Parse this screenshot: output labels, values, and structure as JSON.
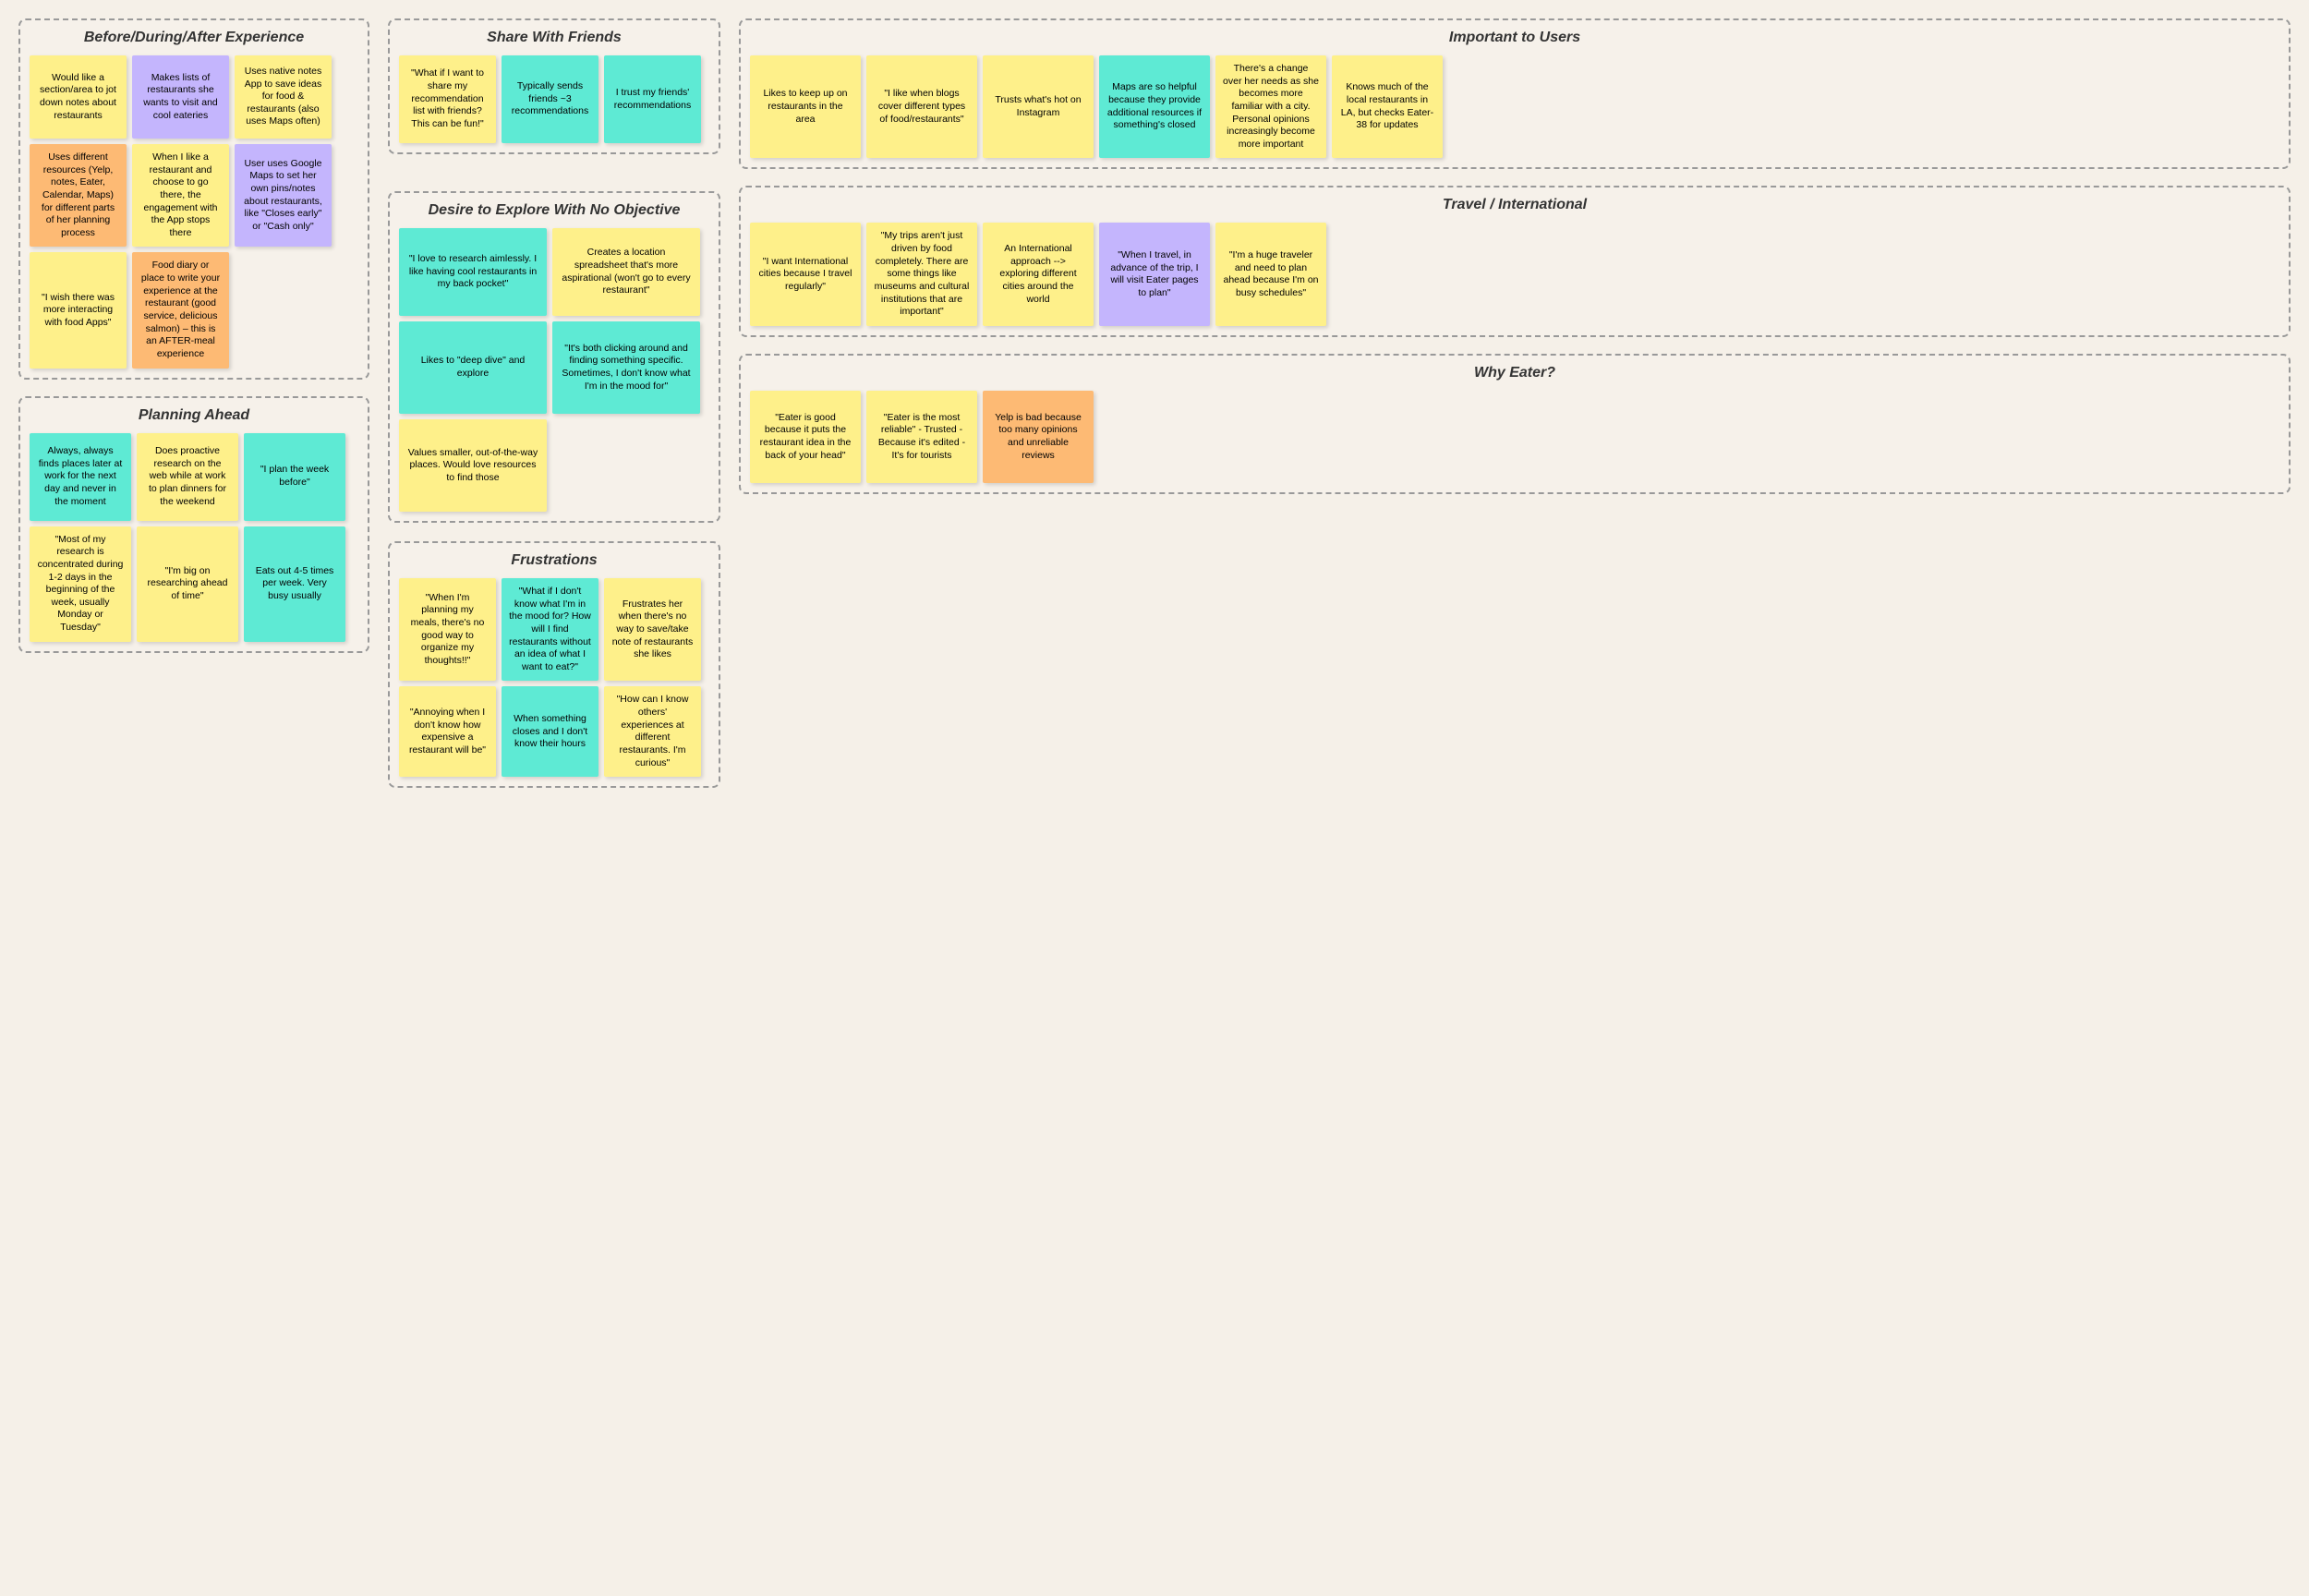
{
  "sections": {
    "before_during_after": {
      "title": "Before/During/After Experience",
      "stickies": [
        {
          "text": "Would like a section/area to jot down notes about restaurants",
          "color": "yellow"
        },
        {
          "text": "Makes lists of restaurants she wants to visit and cool eateries",
          "color": "purple"
        },
        {
          "text": "Uses native notes App to save ideas for food & restaurants (also uses Maps often)",
          "color": "yellow"
        },
        {
          "text": "Uses different resources (Yelp, notes, Eater, Calendar, Maps) for different parts of her planning process",
          "color": "orange"
        },
        {
          "text": "When I like a restaurant and choose to go there, the engagement with the App stops there",
          "color": "yellow"
        },
        {
          "text": "User uses Google Maps to set her own pins/notes about restaurants, like \"Closes early\" or \"Cash only\"",
          "color": "purple"
        },
        {
          "text": "\"I wish there was more interacting with food Apps\"",
          "color": "yellow"
        },
        {
          "text": "Food diary or place to write your experience at the restaurant (good service, delicious salmon) – this is an AFTER-meal experience",
          "color": "orange"
        }
      ]
    },
    "planning_ahead": {
      "title": "Planning Ahead",
      "stickies": [
        {
          "text": "Always, always finds places later at work for the next day and never in the moment",
          "color": "teal"
        },
        {
          "text": "Does proactive research on the web while at work to plan dinners for the weekend",
          "color": "yellow"
        },
        {
          "text": "\"I plan the week before\"",
          "color": "teal"
        },
        {
          "text": "\"Most of my research is concentrated during 1-2 days in the beginning of the week, usually Monday or Tuesday\"",
          "color": "yellow"
        },
        {
          "text": "\"I'm big on researching ahead of time\"",
          "color": "yellow"
        },
        {
          "text": "Eats out 4-5 times per week. Very busy usually",
          "color": "teal"
        }
      ]
    },
    "share_with_friends": {
      "title": "Share With Friends",
      "stickies": [
        {
          "text": "\"What if I want to share my recommendation list with friends? This can be fun!\"",
          "color": "yellow"
        },
        {
          "text": "Typically sends friends ~3 recommendations",
          "color": "teal"
        },
        {
          "text": "I trust my friends' recommendations",
          "color": "teal"
        }
      ]
    },
    "desire_explore": {
      "title": "Desire to Explore With No Objective",
      "stickies": [
        {
          "text": "\"I love to research aimlessly. I like having cool restaurants in my back pocket\"",
          "color": "teal"
        },
        {
          "text": "Creates a location spreadsheet that's more aspirational (won't go to every restaurant\"",
          "color": "yellow"
        },
        {
          "text": "Likes to \"deep dive\" and explore",
          "color": "teal"
        },
        {
          "text": "\"It's both clicking around and finding something specific. Sometimes, I don't know what I'm in the mood for\"",
          "color": "teal"
        },
        {
          "text": "Values smaller, out-of-the-way places. Would love resources to find those",
          "color": "yellow"
        }
      ]
    },
    "frustrations": {
      "title": "Frustrations",
      "stickies": [
        {
          "text": "\"When I'm planning my meals, there's no good way to organize my thoughts!!\"",
          "color": "yellow"
        },
        {
          "text": "\"What if I don't know what I'm in the mood for? How will I find restaurants without an idea of what I want to eat?\"",
          "color": "teal"
        },
        {
          "text": "Frustrates her when there's no way to save/take note of restaurants she likes",
          "color": "yellow"
        },
        {
          "text": "\"Annoying when I don't know how expensive a restaurant will be\"",
          "color": "yellow"
        },
        {
          "text": "When something closes and I don't know their hours",
          "color": "teal"
        },
        {
          "text": "\"How can I know others' experiences at different restaurants. I'm curious\"",
          "color": "yellow"
        }
      ]
    },
    "important_to_users": {
      "title": "Important to Users",
      "stickies": [
        {
          "text": "Likes to keep up on restaurants in the area",
          "color": "yellow"
        },
        {
          "text": "\"I like when blogs cover different types of food/restaurants\"",
          "color": "yellow"
        },
        {
          "text": "Trusts what's hot on Instagram",
          "color": "yellow"
        },
        {
          "text": "Maps are so helpful because they provide additional resources if something's closed",
          "color": "teal"
        },
        {
          "text": "There's a change over her needs as she becomes more familiar with a city. Personal opinions increasingly become more important",
          "color": "yellow"
        },
        {
          "text": "Knows much of the local restaurants in LA, but checks Eater-38 for updates",
          "color": "yellow"
        }
      ]
    },
    "travel_international": {
      "title": "Travel / International",
      "stickies": [
        {
          "text": "\"I want International cities because I travel regularly\"",
          "color": "yellow"
        },
        {
          "text": "\"My trips aren't just driven by food completely. There are some things like museums and cultural institutions that are important\"",
          "color": "yellow"
        },
        {
          "text": "An International approach --> exploring different cities around the world",
          "color": "yellow"
        },
        {
          "text": "\"When I travel, in advance of the trip, I will visit Eater pages to plan\"",
          "color": "purple"
        },
        {
          "text": "\"I'm a huge traveler and need to plan ahead because I'm on busy schedules\"",
          "color": "yellow"
        }
      ]
    },
    "why_eater": {
      "title": "Why Eater?",
      "stickies": [
        {
          "text": "\"Eater is good because it puts the restaurant idea in the back of your head\"",
          "color": "yellow"
        },
        {
          "text": "\"Eater is the most reliable\" - Trusted - Because it's edited - It's for tourists",
          "color": "yellow"
        },
        {
          "text": "Yelp is bad because too many opinions and unreliable reviews",
          "color": "orange"
        }
      ]
    }
  }
}
